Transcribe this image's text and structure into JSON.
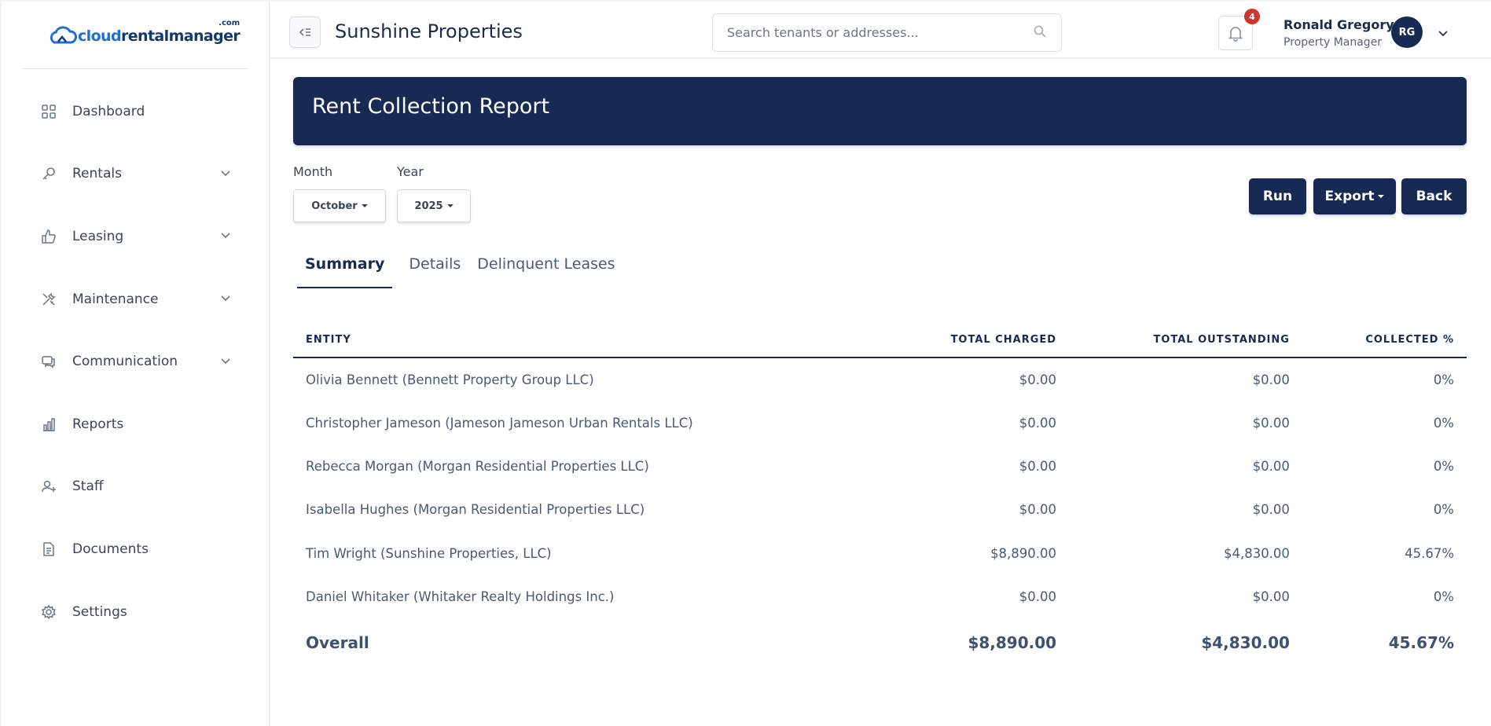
{
  "logo": {
    "part1": "cloud",
    "part2": "rentalmanager",
    "suffix": ".com"
  },
  "sidebar": {
    "items": [
      {
        "label": "Dashboard",
        "icon": "grid-icon",
        "has_submenu": false
      },
      {
        "label": "Rentals",
        "icon": "key-icon",
        "has_submenu": true
      },
      {
        "label": "Leasing",
        "icon": "thumbs-up-icon",
        "has_submenu": true
      },
      {
        "label": "Maintenance",
        "icon": "tools-icon",
        "has_submenu": true
      },
      {
        "label": "Communication",
        "icon": "chat-icon",
        "has_submenu": true
      },
      {
        "label": "Reports",
        "icon": "bar-chart-icon",
        "has_submenu": false
      },
      {
        "label": "Staff",
        "icon": "user-add-icon",
        "has_submenu": false
      },
      {
        "label": "Documents",
        "icon": "document-icon",
        "has_submenu": false
      },
      {
        "label": "Settings",
        "icon": "gear-icon",
        "has_submenu": false
      }
    ]
  },
  "header": {
    "company": "Sunshine Properties",
    "search_placeholder": "Search tenants or addresses...",
    "notification_count": "4",
    "user_name": "Ronald Gregory",
    "user_role": "Property Manager",
    "user_initials": "RG"
  },
  "report": {
    "title": "Rent Collection Report",
    "month_label": "Month",
    "month_value": "October",
    "year_label": "Year",
    "year_value": "2025",
    "buttons": {
      "run": "Run",
      "export": "Export",
      "back": "Back"
    },
    "tabs": [
      "Summary",
      "Details",
      "Delinquent Leases"
    ],
    "active_tab": "Summary"
  },
  "table": {
    "columns": [
      "ENTITY",
      "TOTAL CHARGED",
      "TOTAL OUTSTANDING",
      "COLLECTED %"
    ],
    "rows": [
      {
        "entity": "Olivia Bennett (Bennett Property Group LLC)",
        "charged": "$0.00",
        "outstanding": "$0.00",
        "collected": "0%"
      },
      {
        "entity": "Christopher Jameson (Jameson Jameson Urban Rentals LLC)",
        "charged": "$0.00",
        "outstanding": "$0.00",
        "collected": "0%"
      },
      {
        "entity": "Rebecca Morgan (Morgan Residential Properties LLC)",
        "charged": "$0.00",
        "outstanding": "$0.00",
        "collected": "0%"
      },
      {
        "entity": "Isabella Hughes (Morgan Residential Properties LLC)",
        "charged": "$0.00",
        "outstanding": "$0.00",
        "collected": "0%"
      },
      {
        "entity": "Tim Wright (Sunshine Properties, LLC)",
        "charged": "$8,890.00",
        "outstanding": "$4,830.00",
        "collected": "45.67%"
      },
      {
        "entity": "Daniel Whitaker (Whitaker Realty Holdings Inc.)",
        "charged": "$0.00",
        "outstanding": "$0.00",
        "collected": "0%"
      }
    ],
    "total": {
      "entity": "Overall",
      "charged": "$8,890.00",
      "outstanding": "$4,830.00",
      "collected": "45.67%"
    }
  },
  "colors": {
    "primary": "#162a53",
    "logo_blue": "#1f6fd1",
    "badge_red": "#d0342c"
  }
}
